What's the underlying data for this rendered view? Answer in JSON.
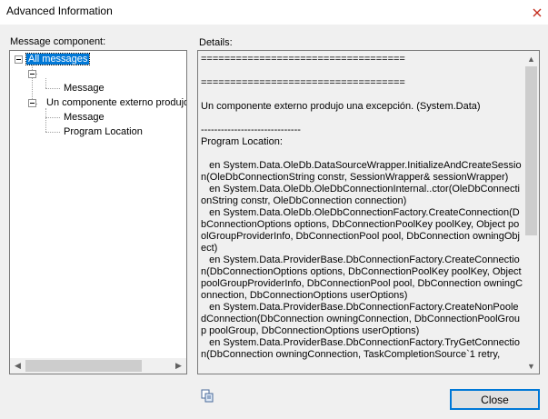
{
  "window": {
    "title": "Advanced Information"
  },
  "labels": {
    "message_component": "Message component:",
    "details": "Details:"
  },
  "tree": {
    "root": "All messages",
    "child1_children": [
      "Message"
    ],
    "child2": "Un componente externo produjo u",
    "child2_children": [
      "Message",
      "Program Location"
    ]
  },
  "details_text": "===================================\n\n===================================\n\nUn componente externo produjo una excepción. (System.Data)\n\n------------------------------\nProgram Location:\n\n   en System.Data.OleDb.DataSourceWrapper.InitializeAndCreateSession(OleDbConnectionString constr, SessionWrapper& sessionWrapper)\n   en System.Data.OleDb.OleDbConnectionInternal..ctor(OleDbConnectionString constr, OleDbConnection connection)\n   en System.Data.OleDb.OleDbConnectionFactory.CreateConnection(DbConnectionOptions options, DbConnectionPoolKey poolKey, Object poolGroupProviderInfo, DbConnectionPool pool, DbConnection owningObject)\n   en System.Data.ProviderBase.DbConnectionFactory.CreateConnection(DbConnectionOptions options, DbConnectionPoolKey poolKey, Object poolGroupProviderInfo, DbConnectionPool pool, DbConnection owningConnection, DbConnectionOptions userOptions)\n   en System.Data.ProviderBase.DbConnectionFactory.CreateNonPooledConnection(DbConnection owningConnection, DbConnectionPoolGroup poolGroup, DbConnectionOptions userOptions)\n   en System.Data.ProviderBase.DbConnectionFactory.TryGetConnection(DbConnection owningConnection, TaskCompletionSource`1 retry,",
  "buttons": {
    "close": "Close"
  },
  "colors": {
    "selection": "#0078d7",
    "accent_border": "#0078d7"
  },
  "icons": {
    "close": "close-icon",
    "copy": "copy-icon"
  }
}
